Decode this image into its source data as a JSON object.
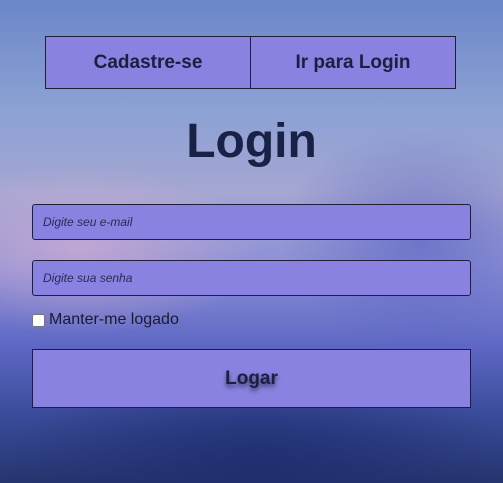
{
  "nav": {
    "register_label": "Cadastre-se",
    "login_label": "Ir para Login"
  },
  "form": {
    "title": "Login",
    "email_placeholder": "Digite seu e-mail",
    "password_placeholder": "Digite sua senha",
    "remember_label": "Manter-me logado",
    "remember_checked": false,
    "submit_label": "Logar"
  },
  "colors": {
    "button_bg": "#8a82e0",
    "text_dark": "#1a2146",
    "border": "#1f1f3a"
  }
}
